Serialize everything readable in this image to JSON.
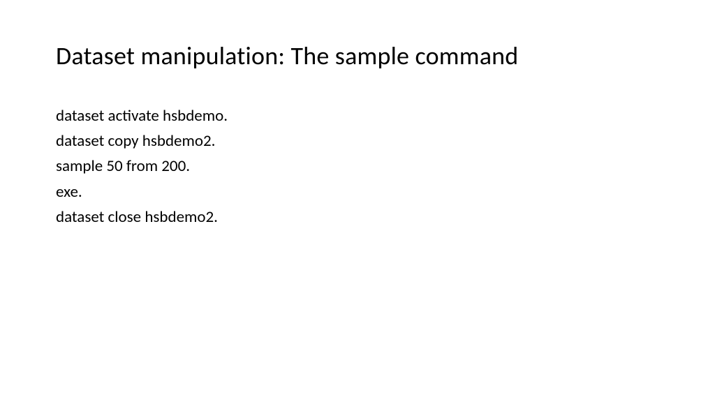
{
  "title": "Dataset manipulation: The sample command",
  "lines": {
    "l0": "dataset activate hsbdemo.",
    "l1": "dataset copy hsbdemo2.",
    "l2": "sample 50 from 200.",
    "l3": "exe.",
    "l4": "dataset close hsbdemo2."
  }
}
